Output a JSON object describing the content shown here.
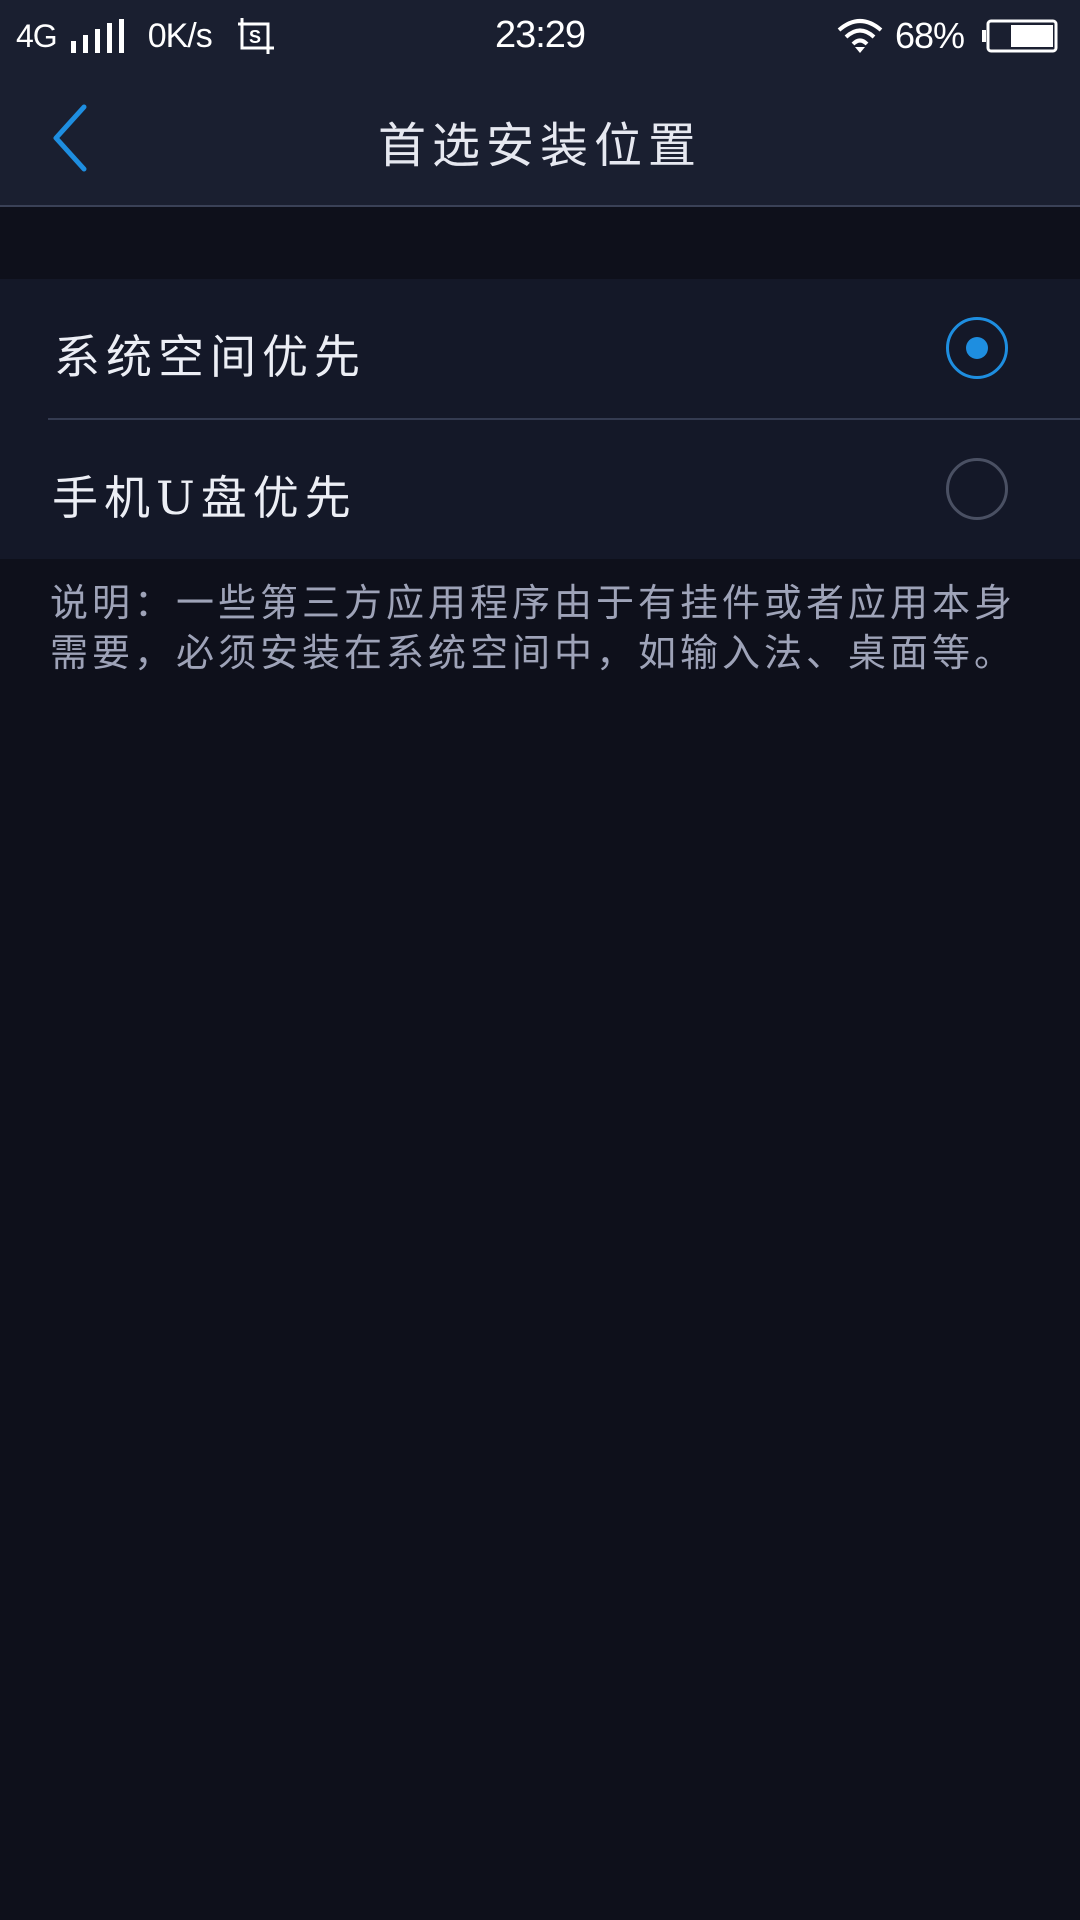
{
  "status_bar": {
    "network": "4G",
    "speed": "0K/s",
    "time": "23:29",
    "battery_percent": "68%",
    "battery_level": 0.68,
    "icons": [
      "signal-icon",
      "screenshot-icon",
      "wifi-icon",
      "battery-icon"
    ]
  },
  "header": {
    "title": "首选安装位置",
    "back_icon": "chevron-left-icon"
  },
  "options": [
    {
      "label": "系统空间优先",
      "selected": true
    },
    {
      "label": "手机U盘优先",
      "selected": false
    }
  ],
  "description": "说明：一些第三方应用程序由于有挂件或者应用本身需要，必须安装在系统空间中，如输入法、桌面等。",
  "colors": {
    "accent": "#1e8ee0",
    "background": "#0e101b",
    "bar": "#1a1f30",
    "row": "#141828"
  }
}
